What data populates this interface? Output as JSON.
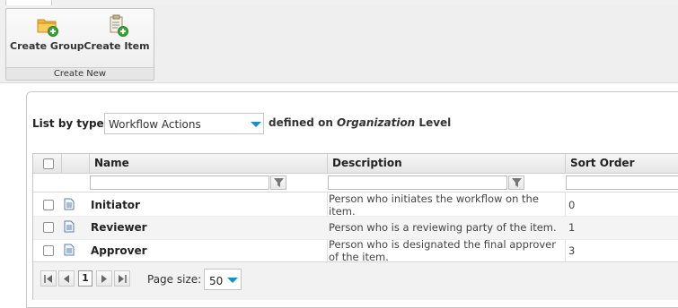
{
  "ribbon": {
    "group_label": "Create New",
    "buttons": [
      {
        "label": "Create Group",
        "icon": "folder-add-icon"
      },
      {
        "label": "Create Item",
        "icon": "clipboard-add-icon"
      }
    ]
  },
  "list": {
    "label": "List by type",
    "type_value": "Workflow Actions",
    "defined_prefix": "defined on",
    "defined_level_em": "Organization",
    "defined_level_suffix": "Level"
  },
  "grid": {
    "columns": [
      "Name",
      "Description",
      "Sort Order"
    ],
    "rows": [
      {
        "name": "Initiator",
        "description": "Person who initiates the workflow on the item.",
        "sort_order": "0"
      },
      {
        "name": "Reviewer",
        "description": "Person who is a reviewing party of the item.",
        "sort_order": "1"
      },
      {
        "name": "Approver",
        "description": "Person who is designated the final approver of the item.",
        "sort_order": "3"
      }
    ]
  },
  "pager": {
    "current_page": "1",
    "page_size_label": "Page size:",
    "page_size_value": "50"
  },
  "colors": {
    "accent": "#1a8fc5",
    "icon_green": "#3aa53a",
    "folder": "#f2b53b"
  }
}
